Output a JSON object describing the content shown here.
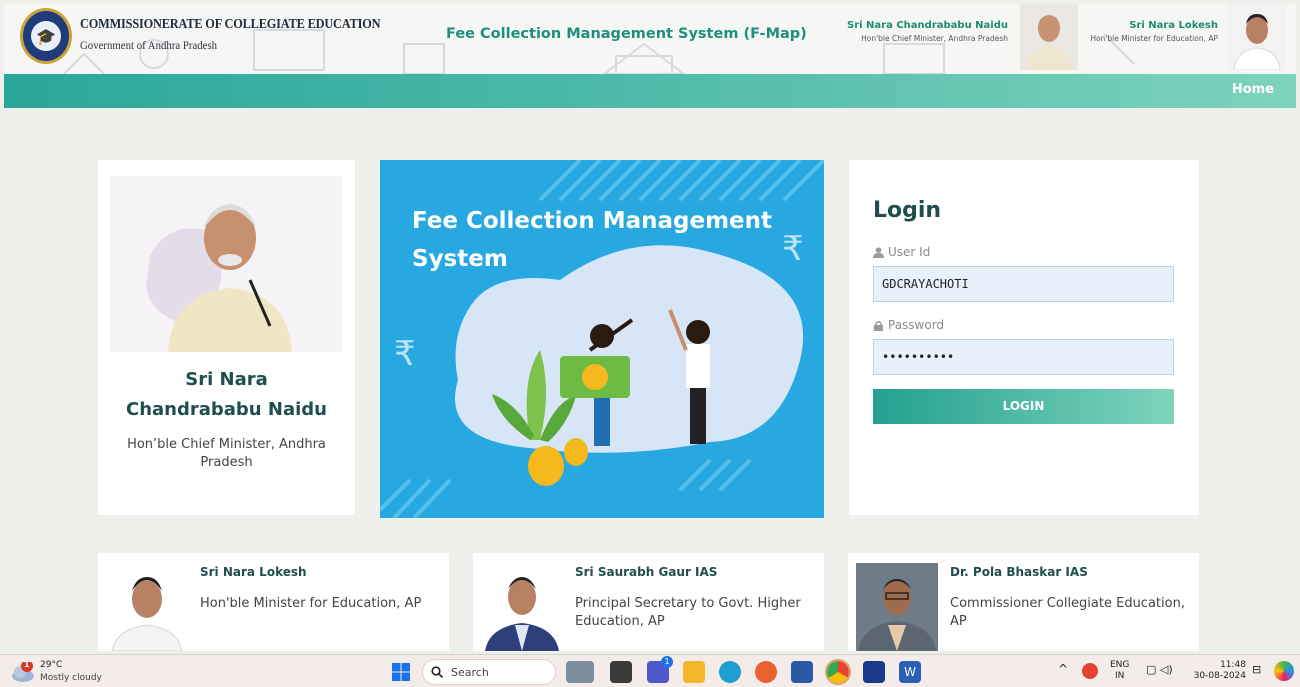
{
  "header": {
    "org_name": "COMMISSIONERATE OF COLLEGIATE EDUCATION",
    "org_sub": "Government of Andhra Pradesh",
    "system_title": "Fee Collection Management System (F-Map)",
    "leader1": {
      "name": "Sri Nara Chandrababu Naidu",
      "role": "Hon'ble Chief Minister, Andhra Pradesh"
    },
    "leader2": {
      "name": "Sri Nara Lokesh",
      "role": "Hon'ble Minister for Education, AP"
    }
  },
  "nav": {
    "home": "Home"
  },
  "cm_card": {
    "name": "Sri Nara Chandrababu Naidu",
    "role": "Hon’ble Chief Minister, Andhra Pradesh"
  },
  "banner": {
    "title": "Fee Collection Management System"
  },
  "login": {
    "title": "Login",
    "user_label": "User Id",
    "user_value": "GDCRAYACHOTI",
    "password_label": "Password",
    "password_value": "••••••••••",
    "button": "LOGIN"
  },
  "profiles": [
    {
      "name": "Sri Nara Lokesh",
      "role": "Hon'ble Minister for Education, AP"
    },
    {
      "name": "Sri Saurabh Gaur IAS",
      "role": "Principal Secretary to Govt. Higher Education, AP"
    },
    {
      "name": "Dr. Pola Bhaskar IAS",
      "role": "Commissioner Collegiate Education, AP"
    }
  ],
  "taskbar": {
    "weather_temp": "29°C",
    "weather_desc": "Mostly cloudy",
    "weather_badge": "1",
    "search_placeholder": "Search",
    "teams_badge": "1",
    "lang_top": "ENG",
    "lang_bottom": "IN",
    "time": "11:48",
    "date": "30-08-2024"
  },
  "colors": {
    "accent": "#1e8f7d",
    "nav_gradient_start": "#2aa79a",
    "nav_gradient_end": "#7ed3bc",
    "banner": "#28a8e0"
  }
}
